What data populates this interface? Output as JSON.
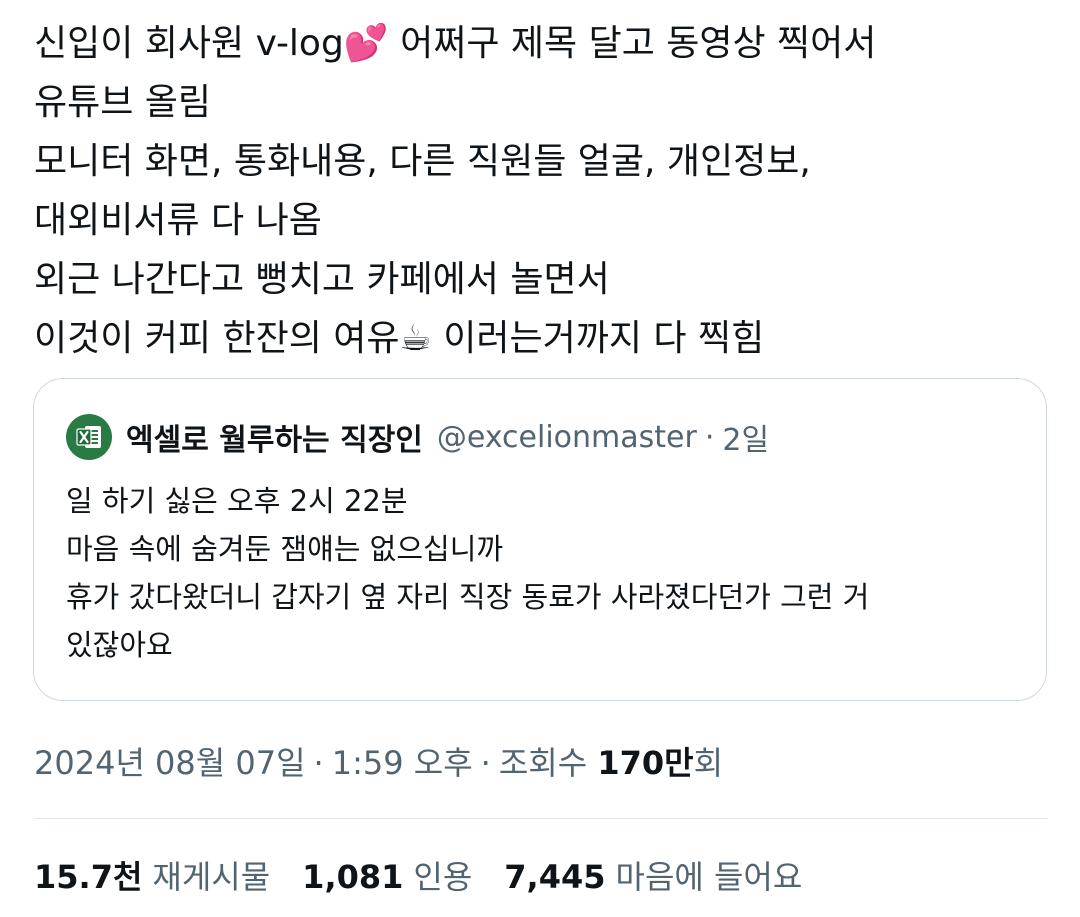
{
  "tweet": {
    "lines": [
      "신입이 회사원 v-log💕 어쩌구 제목 달고 동영상 찍어서",
      "유튜브 올림",
      "모니터 화면, 통화내용, 다른 직원들 얼굴, 개인정보,",
      "대외비서류 다 나옴",
      "외근 나간다고 뻥치고 카페에서 놀면서",
      "이것이 커피 한잔의 여유☕ 이러는거까지 다 찍힘"
    ]
  },
  "quote": {
    "avatar_icon": "excel-icon",
    "name": "엑셀로 월루하는 직장인",
    "handle": "@excelionmaster",
    "dot": "·",
    "time": "2일",
    "lines": [
      "일 하기 싫은 오후 2시 22분",
      "마음 속에 숨겨둔 잼얘는 없으십니까",
      "휴가 갔다왔더니 갑자기 옆 자리 직장 동료가 사라졌다던가 그런 거",
      "있잖아요"
    ]
  },
  "meta": {
    "date": "2024년 08월 07일",
    "sep1": "·",
    "time": "1:59 오후",
    "sep2": "·",
    "views_label": "조회수",
    "views_number": "170만",
    "views_suffix": "회"
  },
  "stats": {
    "reposts_number": "15.7천",
    "reposts_label": "재게시물",
    "quotes_number": "1,081",
    "quotes_label": "인용",
    "likes_number": "7,445",
    "likes_label": "마음에 들어요"
  },
  "colors": {
    "text": "#0f1419",
    "secondary": "#536471",
    "border": "#cfd9de",
    "excel_green": "#2a7a46"
  }
}
